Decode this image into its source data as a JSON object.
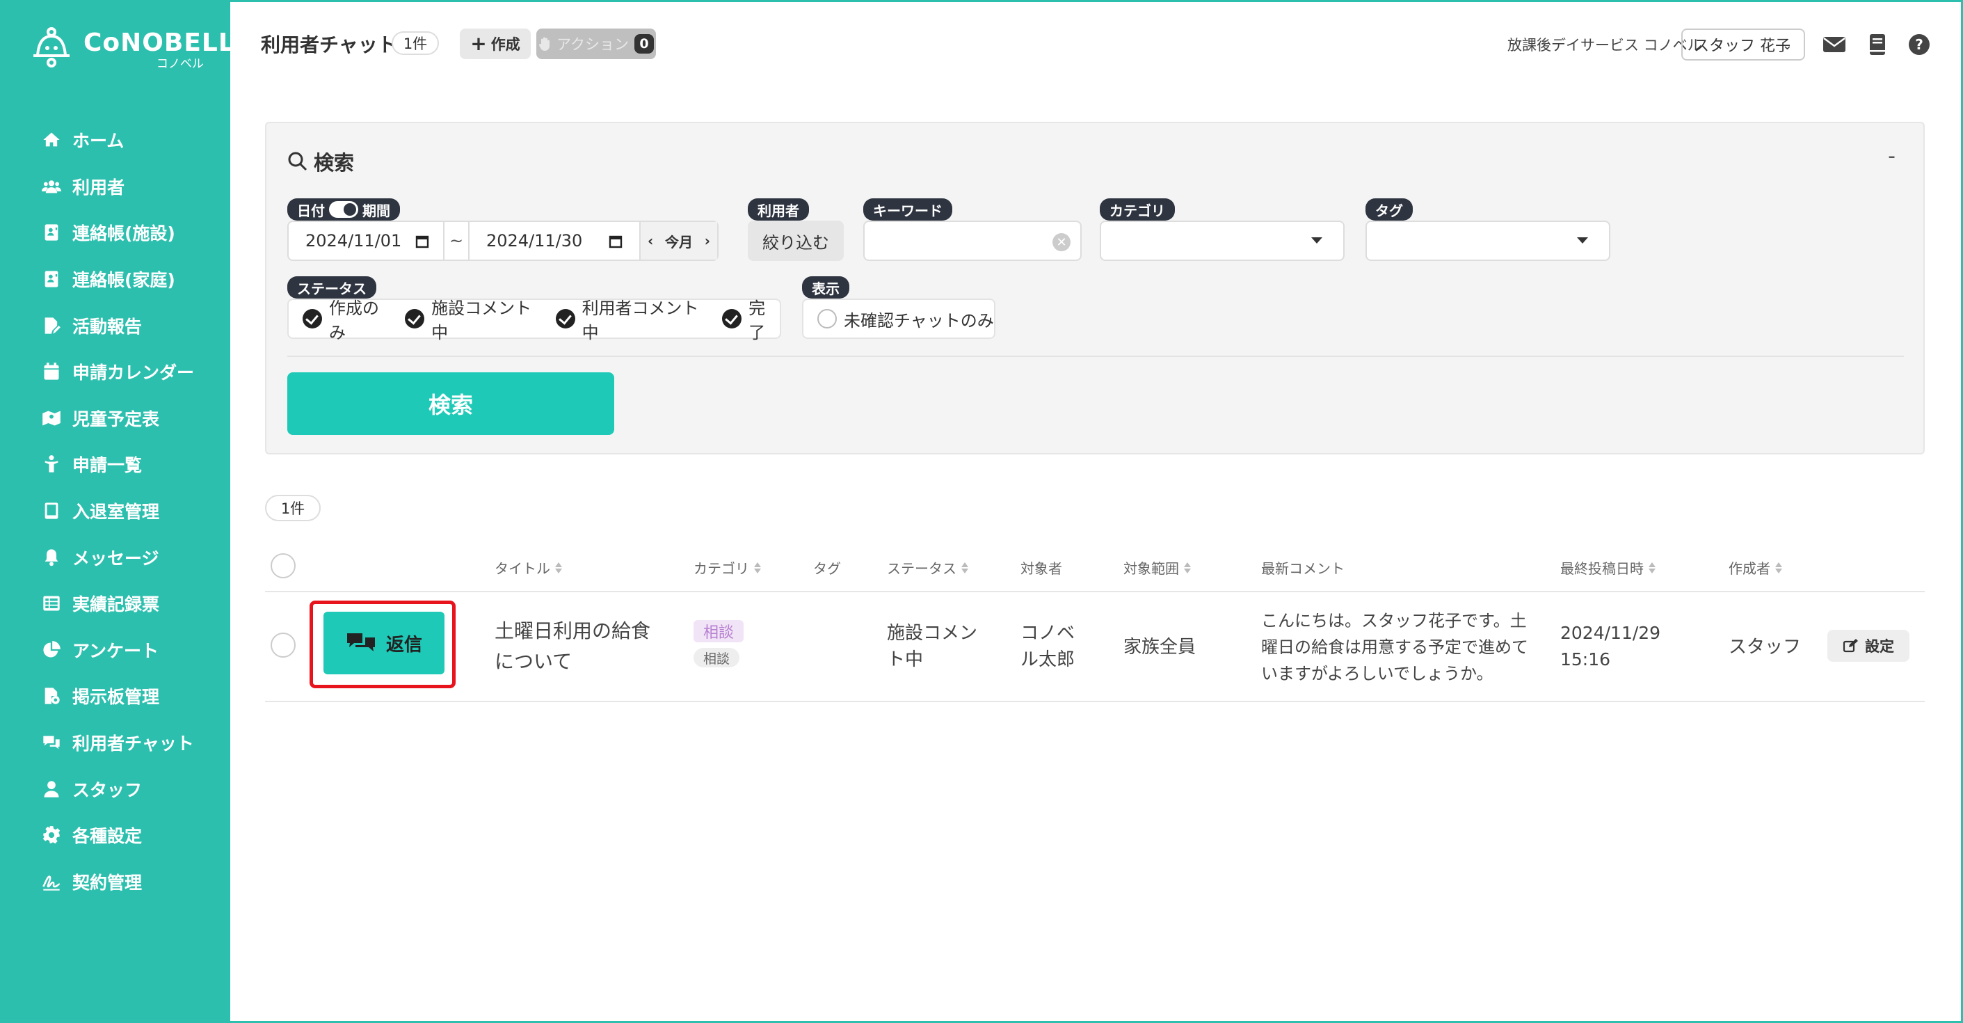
{
  "brand": {
    "title": "CoNOBELL",
    "subtitle": "コノベル"
  },
  "sidebar": {
    "items": [
      {
        "label": "ホーム",
        "icon": "home-icon"
      },
      {
        "label": "利用者",
        "icon": "users-icon"
      },
      {
        "label": "連絡帳(施設)",
        "icon": "contact-book-icon"
      },
      {
        "label": "連絡帳(家庭)",
        "icon": "contact-book-icon"
      },
      {
        "label": "活動報告",
        "icon": "file-edit-icon"
      },
      {
        "label": "申請カレンダー",
        "icon": "calendar-icon"
      },
      {
        "label": "児童予定表",
        "icon": "map-icon"
      },
      {
        "label": "申請一覧",
        "icon": "child-icon"
      },
      {
        "label": "入退室管理",
        "icon": "tablet-icon"
      },
      {
        "label": "メッセージ",
        "icon": "bell-icon"
      },
      {
        "label": "実績記録票",
        "icon": "table-icon"
      },
      {
        "label": "アンケート",
        "icon": "pie-chart-icon"
      },
      {
        "label": "掲示板管理",
        "icon": "file-settings-icon"
      },
      {
        "label": "利用者チャット",
        "icon": "chat-icon"
      },
      {
        "label": "スタッフ",
        "icon": "user-icon"
      },
      {
        "label": "各種設定",
        "icon": "gear-icon"
      },
      {
        "label": "契約管理",
        "icon": "signature-icon"
      }
    ]
  },
  "header": {
    "title": "利用者チャット",
    "count": "1件",
    "create_label": "作成",
    "action_label": "アクション",
    "action_count": "0",
    "facility": "放課後デイサービス コノベル",
    "staff": "スタッフ 花子"
  },
  "search": {
    "title": "検索",
    "collapse": "-",
    "date_tag_a": "日付",
    "date_tag_b": "期間",
    "date_from": "2024/11/01",
    "date_sep": "~",
    "date_to": "2024/11/30",
    "this_month": "今月",
    "user_tag": "利用者",
    "narrow_label": "絞り込む",
    "keyword_tag": "キーワード",
    "keyword_value": "",
    "category_tag": "カテゴリ",
    "category_value": "",
    "tag_tag": "タグ",
    "tag_value": "",
    "status_tag": "ステータス",
    "statuses": [
      "作成のみ",
      "施設コメント中",
      "利用者コメント中",
      "完了"
    ],
    "display_tag": "表示",
    "unconfirmed_label": "未確認チャットのみ",
    "button": "検索"
  },
  "results": {
    "count": "1件",
    "columns": [
      "タイトル",
      "カテゴリ",
      "タグ",
      "ステータス",
      "対象者",
      "対象範囲",
      "最新コメント",
      "最終投稿日時",
      "作成者"
    ],
    "rows": [
      {
        "reply": "返信",
        "title": "土曜日利用の給食について",
        "category": "相談",
        "category_sub": "相談",
        "tag": "",
        "status": "施設コメント中",
        "target": "コノベル太郎",
        "scope": "家族全員",
        "latest_comment": "こんにちは。スタッフ花子です。土曜日の給食は用意する予定で進めていますがよろしいでしょうか。",
        "posted": "2024/11/29 15:16",
        "author": "スタッフ",
        "settings": "設定"
      }
    ]
  }
}
